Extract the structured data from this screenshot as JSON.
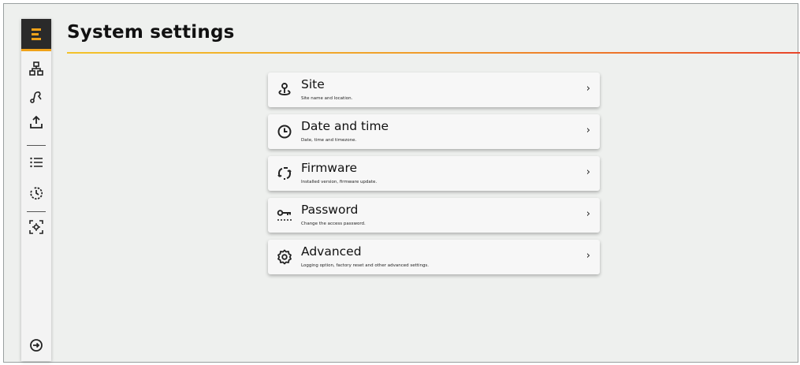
{
  "page": {
    "title": "System settings"
  },
  "sidebar": {
    "items": [
      {
        "name": "network-icon"
      },
      {
        "name": "route-icon"
      },
      {
        "name": "upload-icon"
      },
      {
        "name": "list-icon"
      },
      {
        "name": "history-icon"
      },
      {
        "name": "scan-icon"
      },
      {
        "name": "logout-icon"
      }
    ],
    "accent": "#f0a21a"
  },
  "settings": [
    {
      "title": "Site",
      "subtitle": "Site name and location.",
      "icon": "location-pin-icon",
      "chevron": "›"
    },
    {
      "title": "Date and time",
      "subtitle": "Date, time and timezone.",
      "icon": "clock-icon",
      "chevron": "›"
    },
    {
      "title": "Firmware",
      "subtitle": "Installed version, firmware update.",
      "icon": "refresh-icon",
      "chevron": "›"
    },
    {
      "title": "Password",
      "subtitle": "Change the access password.",
      "icon": "key-icon",
      "chevron": "›"
    },
    {
      "title": "Advanced",
      "subtitle": "Logging option, factory reset and other advanced settings.",
      "icon": "gear-icon",
      "chevron": "›"
    }
  ]
}
